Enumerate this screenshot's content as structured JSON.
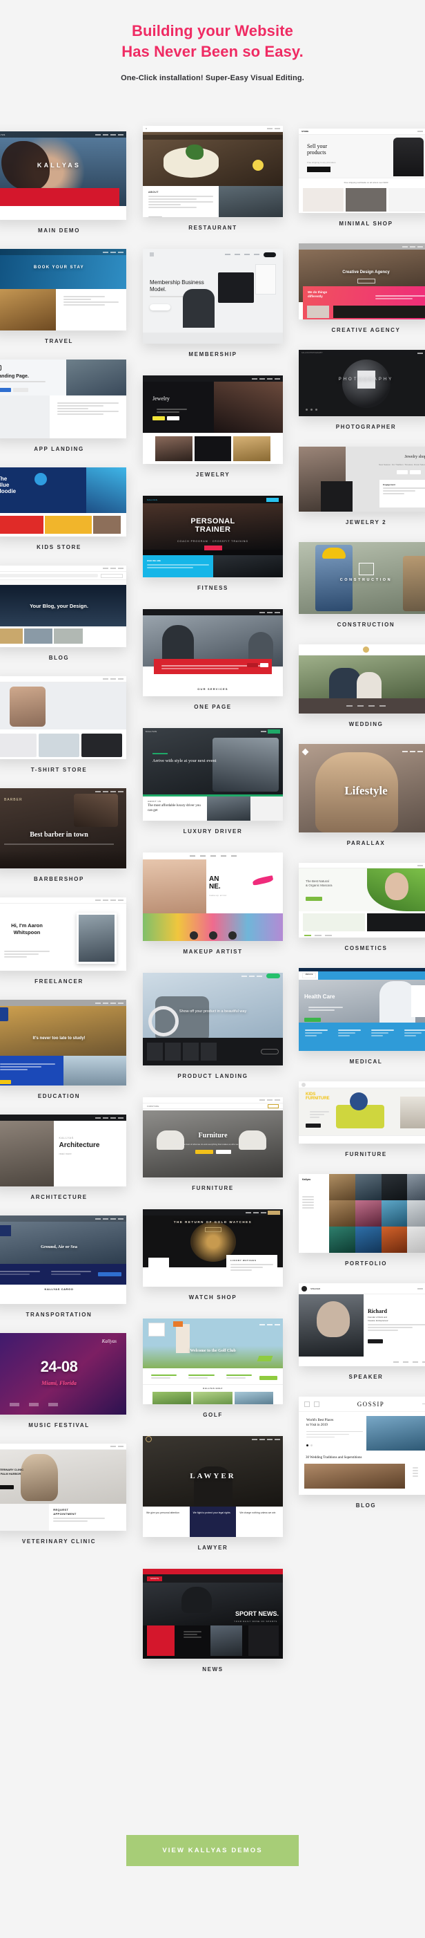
{
  "hero": {
    "title_line1": "Building your Website",
    "title_line2": "Has Never Been so Easy.",
    "subtitle": "One-Click installation! Super-Easy Visual Editing.",
    "accent_color": "#ef2b63"
  },
  "cta": {
    "label": "VIEW KALLYAS DEMOS",
    "color": "#a7cd77"
  },
  "columns": {
    "left": [
      {
        "label": "MAIN DEMO",
        "headline": "KALLYAS",
        "kind": "main"
      },
      {
        "label": "TRAVEL",
        "headline": "BOOK YOUR STAY",
        "kind": "travel"
      },
      {
        "label": "APP LANDING",
        "headline": "Landing Page.",
        "kind": "app"
      },
      {
        "label": "KIDS STORE",
        "headline": "The Blue Hoodie",
        "kind": "kids"
      },
      {
        "label": "BLOG",
        "headline": "Your Blog, your Design.",
        "kind": "blog"
      },
      {
        "label": "T-SHIRT STORE",
        "headline": "",
        "kind": "tshirt"
      },
      {
        "label": "BARBERSHOP",
        "headline": "Best barber in town",
        "kind": "barber"
      },
      {
        "label": "FREELANCER",
        "headline": "Hi, I'm Aaron Whitspoon",
        "kind": "freelancer"
      },
      {
        "label": "EDUCATION",
        "headline": "It's never too late to study!",
        "kind": "education"
      },
      {
        "label": "ARCHITECTURE",
        "headline": "Architecture",
        "kind": "architecture"
      },
      {
        "label": "TRANSPORTATION",
        "headline": "Ground, Air or Sea",
        "kind": "transportation"
      },
      {
        "label": "MUSIC FESTIVAL",
        "headline": "24-08",
        "kind": "music"
      },
      {
        "label": "VETERINARY CLINIC",
        "headline": "REQUEST APPOINTMENT",
        "kind": "vet"
      }
    ],
    "mid": [
      {
        "label": "RESTAURANT",
        "headline": "",
        "kind": "restaurant"
      },
      {
        "label": "MEMBERSHIP",
        "headline": "Membership Business Model.",
        "kind": "membership"
      },
      {
        "label": "JEWELRY",
        "headline": "Jewelry",
        "kind": "jewelry"
      },
      {
        "label": "FITNESS",
        "headline": "PERSONAL TRAINER",
        "kind": "fitness"
      },
      {
        "label": "ONE PAGE",
        "headline": "OUR SERVICES",
        "kind": "onepage"
      },
      {
        "label": "LUXURY DRIVER",
        "headline": "Arrive with style at your next event",
        "kind": "luxury"
      },
      {
        "label": "MAKEUP ARTIST",
        "headline": "ANNE.",
        "kind": "makeup"
      },
      {
        "label": "PRODUCT LANDING",
        "headline": "Show off your product in a beautiful way",
        "kind": "product"
      },
      {
        "label": "FURNITURE",
        "headline": "Furniture",
        "kind": "furniture1"
      },
      {
        "label": "WATCH SHOP",
        "headline": "THE RETURN OF GOLD WATCHES",
        "kind": "watch"
      },
      {
        "label": "GOLF",
        "headline": "Welcome to the Golf Club",
        "kind": "golf"
      },
      {
        "label": "LAWYER",
        "headline": "LAWYER",
        "kind": "lawyer"
      },
      {
        "label": "NEWS",
        "headline": "SPORT NEWS.",
        "kind": "news"
      }
    ],
    "right": [
      {
        "label": "MINIMAL SHOP",
        "headline": "Sell your products",
        "kind": "minimal"
      },
      {
        "label": "CREATIVE AGENCY",
        "headline": "Creative Design Agency",
        "kind": "creative"
      },
      {
        "label": "PHOTOGRAPHER",
        "headline": "PHOTOGRAPHY",
        "kind": "photographer"
      },
      {
        "label": "JEWELRY 2",
        "headline": "Jewelry shop",
        "kind": "jewelry2"
      },
      {
        "label": "CONSTRUCTION",
        "headline": "CONSTRUCTION",
        "kind": "construction"
      },
      {
        "label": "WEDDING",
        "headline": "",
        "kind": "wedding"
      },
      {
        "label": "PARALLAX",
        "headline": "Lifestyle",
        "kind": "parallax"
      },
      {
        "label": "COSMETICS",
        "headline": "The Best Natural & Organic Mascara",
        "kind": "cosmetics"
      },
      {
        "label": "MEDICAL",
        "headline": "Health Care",
        "kind": "medical"
      },
      {
        "label": "FURNITURE",
        "headline": "KIDS FURNITURE",
        "kind": "furniture2"
      },
      {
        "label": "PORTFOLIO",
        "headline": "",
        "kind": "portfolio"
      },
      {
        "label": "SPEAKER",
        "headline": "Richard",
        "kind": "speaker"
      },
      {
        "label": "BLOG",
        "headline": "GOSSIP",
        "kind": "blog2"
      }
    ]
  }
}
